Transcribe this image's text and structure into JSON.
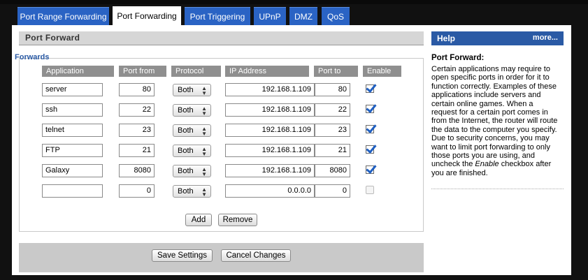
{
  "tabs": [
    {
      "label": "Port Range Forwarding",
      "active": false
    },
    {
      "label": "Port Forwarding",
      "active": true
    },
    {
      "label": "Port Triggering",
      "active": false
    },
    {
      "label": "UPnP",
      "active": false
    },
    {
      "label": "DMZ",
      "active": false
    },
    {
      "label": "QoS",
      "active": false
    }
  ],
  "section_title": "Port Forward",
  "forwards_label": "Forwards",
  "columns": {
    "application": "Application",
    "port_from": "Port from",
    "protocol": "Protocol",
    "ip": "IP Address",
    "port_to": "Port to",
    "enable": "Enable"
  },
  "rows": [
    {
      "application": "server",
      "port_from": "80",
      "protocol": "Both",
      "ip": "192.168.1.109",
      "port_to": "80",
      "enabled": true
    },
    {
      "application": "ssh",
      "port_from": "22",
      "protocol": "Both",
      "ip": "192.168.1.109",
      "port_to": "22",
      "enabled": true
    },
    {
      "application": "telnet",
      "port_from": "23",
      "protocol": "Both",
      "ip": "192.168.1.109",
      "port_to": "23",
      "enabled": true
    },
    {
      "application": "FTP",
      "port_from": "21",
      "protocol": "Both",
      "ip": "192.168.1.109",
      "port_to": "21",
      "enabled": true
    },
    {
      "application": "Galaxy",
      "port_from": "8080",
      "protocol": "Both",
      "ip": "192.168.1.109",
      "port_to": "8080",
      "enabled": true
    },
    {
      "application": "",
      "port_from": "0",
      "protocol": "Both",
      "ip": "0.0.0.0",
      "port_to": "0",
      "enabled": false
    }
  ],
  "buttons": {
    "add": "Add",
    "remove": "Remove",
    "save": "Save Settings",
    "cancel": "Cancel Changes"
  },
  "help": {
    "header": "Help",
    "more": "more...",
    "title": "Port Forward:",
    "text_before": "Certain applications may require to open specific ports in order for it to function correctly. Examples of these applications include servers and certain online games. When a request for a certain port comes in from the Internet, the router will route the data to the computer you specify. Due to security concerns, you may want to limit port forwarding to only those ports you are using, and uncheck the ",
    "text_em": "Enable",
    "text_after": " checkbox after you are finished."
  },
  "colors": {
    "tab_blue": "#2a63c4",
    "help_blue": "#2a5aa5",
    "check_blue": "#1f5fc1",
    "header_gray": "#8f8f8f"
  }
}
